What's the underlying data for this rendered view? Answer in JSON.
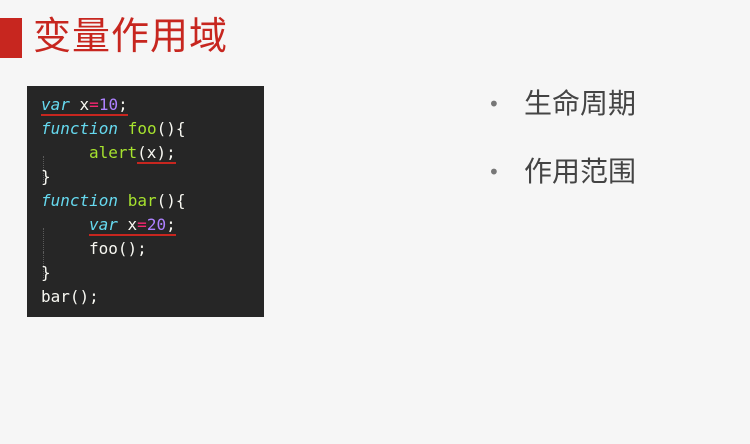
{
  "title": "变量作用域",
  "code": {
    "line1": {
      "kw": "var",
      "name": " x",
      "op": "=",
      "num": "10",
      "end": ";"
    },
    "line2": {
      "kw": "function",
      "space": " ",
      "name": "foo",
      "end": "(){"
    },
    "line3": {
      "fn": "alert",
      "args": "(x);"
    },
    "line4": "}",
    "line5": {
      "kw": "function",
      "space": " ",
      "name": "bar",
      "end": "(){"
    },
    "line6": {
      "kw": "var",
      "name": " x",
      "op": "=",
      "num": "20",
      "end": ";"
    },
    "line7": "foo();",
    "line8": "}",
    "line9": "bar();"
  },
  "bullets": [
    {
      "dot": "•",
      "label": "生命周期"
    },
    {
      "dot": "•",
      "label": "作用范围"
    }
  ],
  "colors": {
    "accent": "#c7261f",
    "code_bg": "#262626",
    "keyword": "#66d9ef",
    "function": "#a6e22e",
    "operator": "#f92672",
    "number": "#ae81ff"
  }
}
